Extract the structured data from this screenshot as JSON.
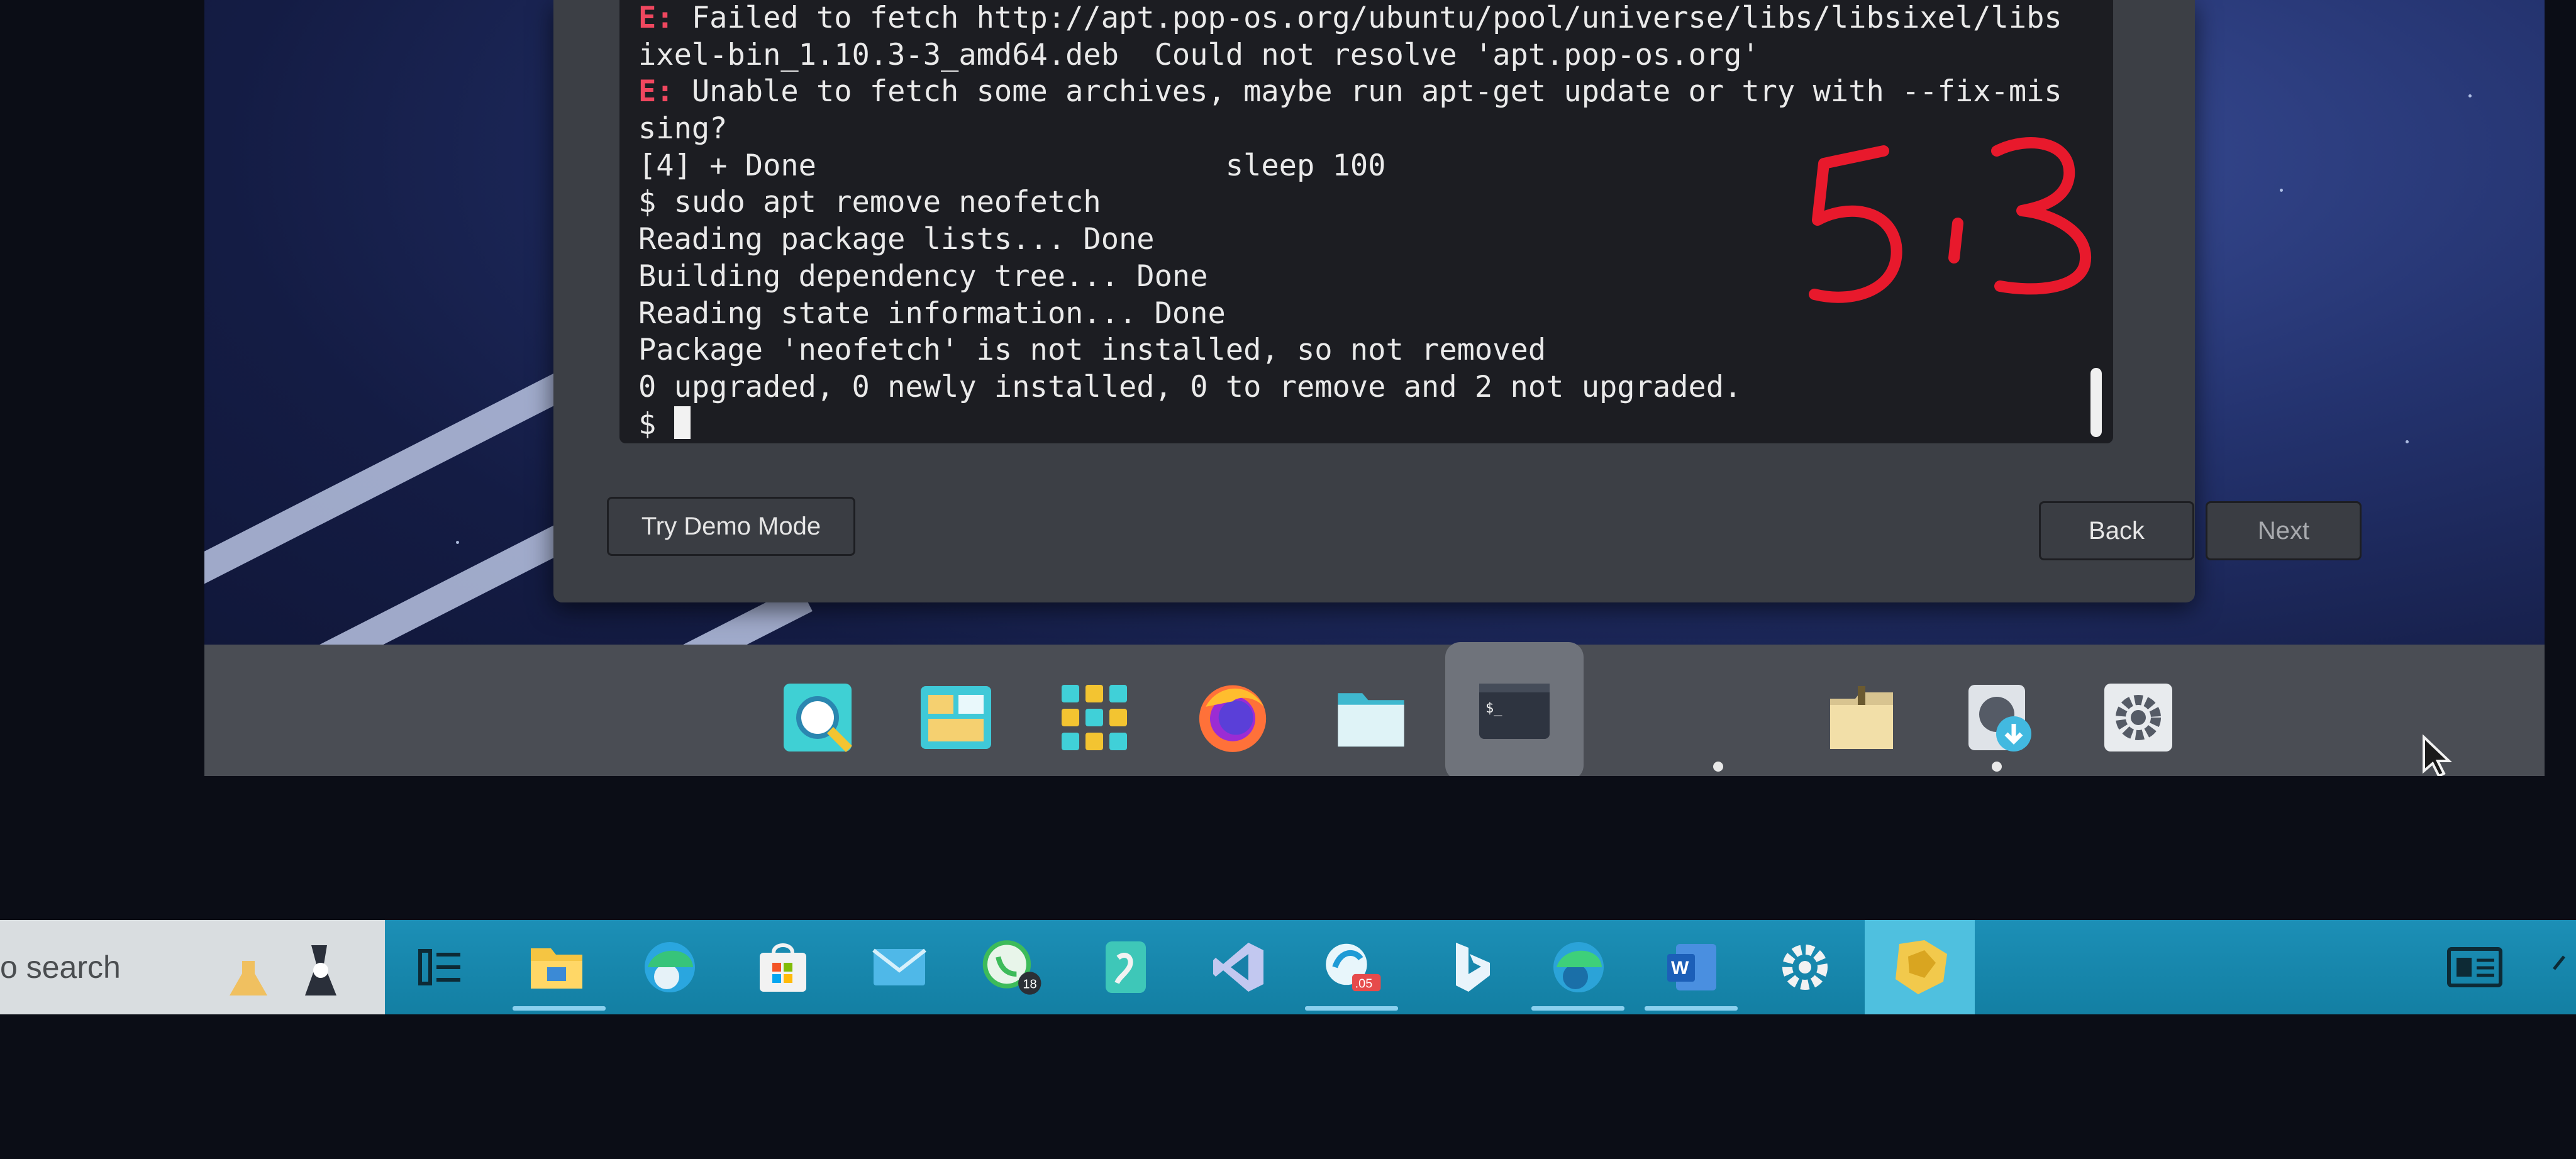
{
  "terminal": {
    "lines": [
      {
        "prefix": "E:",
        "text": " Failed to fetch http://apt.pop-os.org/ubuntu/pool/universe/libs/libsixel/libs"
      },
      {
        "prefix": "",
        "text": "ixel-bin_1.10.3-3_amd64.deb  Could not resolve 'apt.pop-os.org'"
      },
      {
        "prefix": "E:",
        "text": " Unable to fetch some archives, maybe run apt-get update or try with --fix-mis"
      },
      {
        "prefix": "",
        "text": "sing?"
      },
      {
        "prefix": "",
        "text": "[4] + Done                       sleep 100"
      },
      {
        "prefix": "",
        "text": "$ sudo apt remove neofetch"
      },
      {
        "prefix": "",
        "text": "Reading package lists... Done"
      },
      {
        "prefix": "",
        "text": "Building dependency tree... Done"
      },
      {
        "prefix": "",
        "text": "Reading state information... Done"
      },
      {
        "prefix": "",
        "text": "Package 'neofetch' is not installed, so not removed"
      },
      {
        "prefix": "",
        "text": "0 upgraded, 0 newly installed, 0 to remove and 2 not upgraded."
      }
    ],
    "prompt": "$"
  },
  "installer": {
    "demo_label": "Try Demo Mode",
    "back_label": "Back",
    "next_label": "Next"
  },
  "annotation": {
    "text": "5.3"
  },
  "dock": {
    "items": [
      "search-app",
      "workspaces",
      "app-grid",
      "firefox",
      "files",
      "terminal",
      "archive-manager",
      "installer",
      "settings"
    ]
  },
  "taskbar": {
    "search_text": "o search",
    "whatsapp_badge": "18",
    "badge_text": ".05",
    "word_letter": "W",
    "items": [
      "task-view",
      "file-explorer",
      "edge-beta",
      "microsoft-store",
      "mail",
      "whatsapp",
      "phone-link",
      "visual-studio",
      "app-badge",
      "bing",
      "edge",
      "word",
      "settings",
      "vm-app"
    ]
  },
  "colors": {
    "error": "#f0475f",
    "terminal_bg": "#1c1d22",
    "annotation": "#e8192c",
    "taskbar": "#1788ad"
  }
}
